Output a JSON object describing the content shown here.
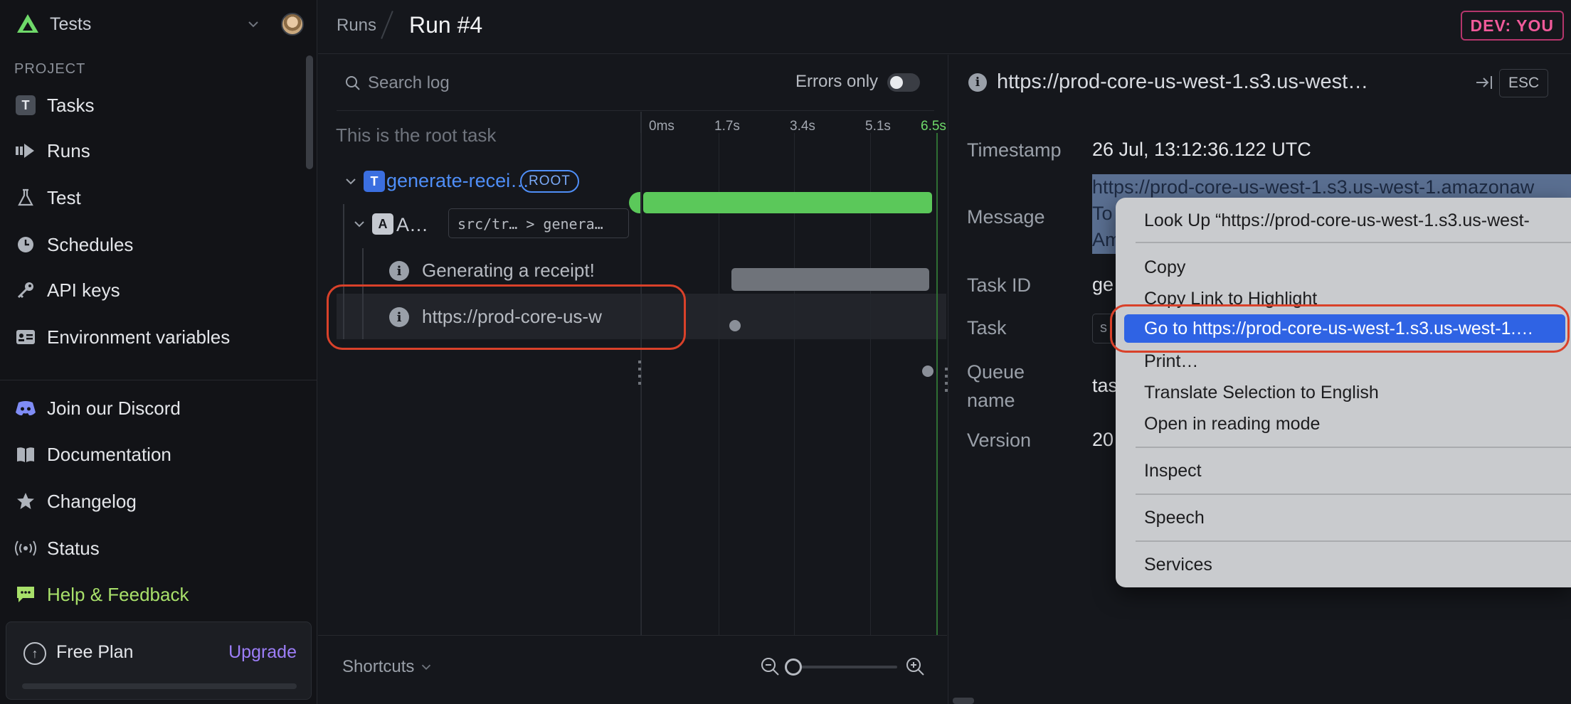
{
  "sidebar": {
    "project_name": "Tests",
    "section_label": "PROJECT",
    "nav_items": [
      {
        "label": "Tasks",
        "icon": "tasks-icon"
      },
      {
        "label": "Runs",
        "icon": "runs-icon"
      },
      {
        "label": "Test",
        "icon": "flask-icon"
      },
      {
        "label": "Schedules",
        "icon": "clock-icon"
      },
      {
        "label": "API keys",
        "icon": "key-icon"
      },
      {
        "label": "Environment variables",
        "icon": "id-card-icon"
      }
    ],
    "footer_items": [
      {
        "label": "Join our Discord",
        "icon": "discord-icon"
      },
      {
        "label": "Documentation",
        "icon": "book-icon"
      },
      {
        "label": "Changelog",
        "icon": "star-icon"
      },
      {
        "label": "Status",
        "icon": "broadcast-icon"
      },
      {
        "label": "Help & Feedback",
        "icon": "chat-icon"
      }
    ],
    "plan": {
      "label": "Free Plan",
      "upgrade_label": "Upgrade"
    },
    "tasks_badge": "T"
  },
  "topbar": {
    "breadcrumb_runs": "Runs",
    "run_title": "Run #4",
    "env_badge": "DEV: YOU"
  },
  "log": {
    "search_placeholder": "Search log",
    "errors_only_label": "Errors only",
    "root_caption": "This is the root task",
    "root_task": {
      "badge": "T",
      "name": "generate-recei…",
      "tag": "ROOT"
    },
    "attempt": {
      "badge": "A",
      "name": "A…",
      "path": "src/tr…  > genera…"
    },
    "events": [
      {
        "text": "Generating a receipt!"
      },
      {
        "text": "https://prod-core-us-w"
      }
    ],
    "timeline_ticks": [
      "0ms",
      "1.7s",
      "3.4s",
      "5.1s",
      "6.5s"
    ],
    "shortcuts_label": "Shortcuts"
  },
  "detail": {
    "title": "https://prod-core-us-west-1.s3.us-west…",
    "esc_label": "ESC",
    "props": {
      "timestamp_label": "Timestamp",
      "timestamp_value": "26 Jul, 13:12:36.122 UTC",
      "message_label": "Message",
      "message_lines": [
        "https://prod-core-us-west-1.s3.us-west-1.amazonaw",
        "To",
        "Am"
      ],
      "task_id_label": "Task ID",
      "task_id_value": "ge",
      "task_label": "Task",
      "task_value": "s",
      "queue_label_1": "Queue",
      "queue_label_2": "name",
      "queue_value": "tas",
      "version_label": "Version",
      "version_value": "20"
    }
  },
  "context_menu": {
    "look_up": "Look Up “https://prod-core-us-west-1.s3.us-west-",
    "copy": "Copy",
    "copy_link": "Copy Link to Highlight",
    "go_to": "Go to https://prod-core-us-west-1.s3.us-west-1.…",
    "print": "Print…",
    "translate": "Translate Selection to English",
    "reading_mode": "Open in reading mode",
    "inspect": "Inspect",
    "speech": "Speech",
    "services": "Services"
  },
  "colors": {
    "accent_blue": "#4f8ef7",
    "success_green": "#5bc85a",
    "help_green": "#a8e06a",
    "upgrade_purple": "#9d7ef8",
    "env_pink": "#f05a9a",
    "annotation_red": "#d9412a",
    "menu_highlight": "#2f63e4"
  }
}
